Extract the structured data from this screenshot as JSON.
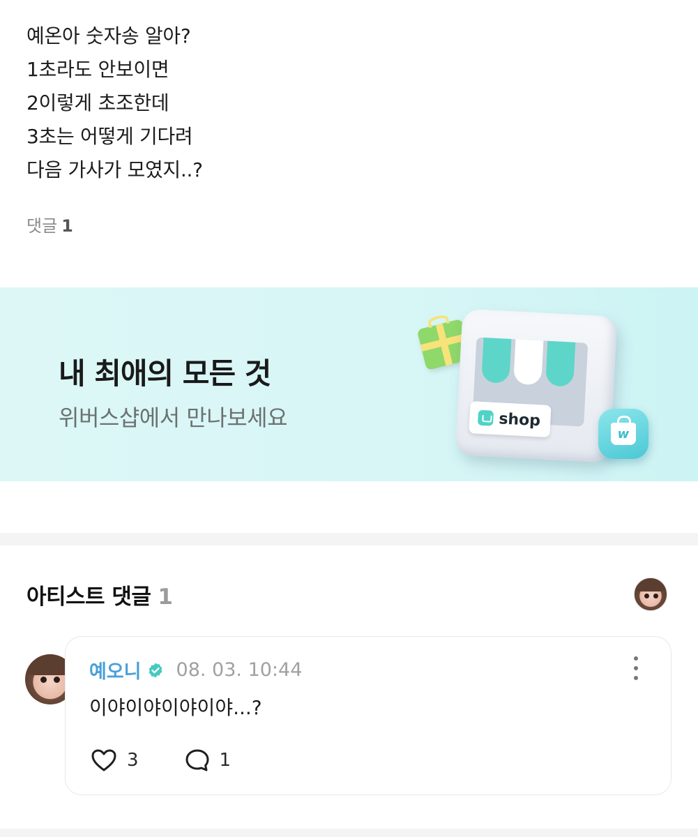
{
  "post": {
    "lines": [
      "예온아 숫자송 알아?",
      "1초라도 안보이면",
      "2이렇게 초조한데",
      "3초는 어떻게 기다려",
      "다음 가사가 모였지..?"
    ],
    "comment_label": "댓글",
    "comment_count": "1"
  },
  "banner": {
    "title": "내 최애의 모든 것",
    "subtitle": "위버스샵에서 만나보세요",
    "shop_sign": "shop",
    "bag_letter": "w",
    "bg_color": "#d8f6f6",
    "accent": "#4fd3c6"
  },
  "artist_section": {
    "title": "아티스트 댓글",
    "count": "1"
  },
  "comment": {
    "author": "예오니",
    "author_color": "#4aa0d8",
    "verified_icon": "verified-badge-icon",
    "timestamp": "08. 03. 10:44",
    "text": "이야이야이야이야...?",
    "likes": "3",
    "replies": "1"
  }
}
